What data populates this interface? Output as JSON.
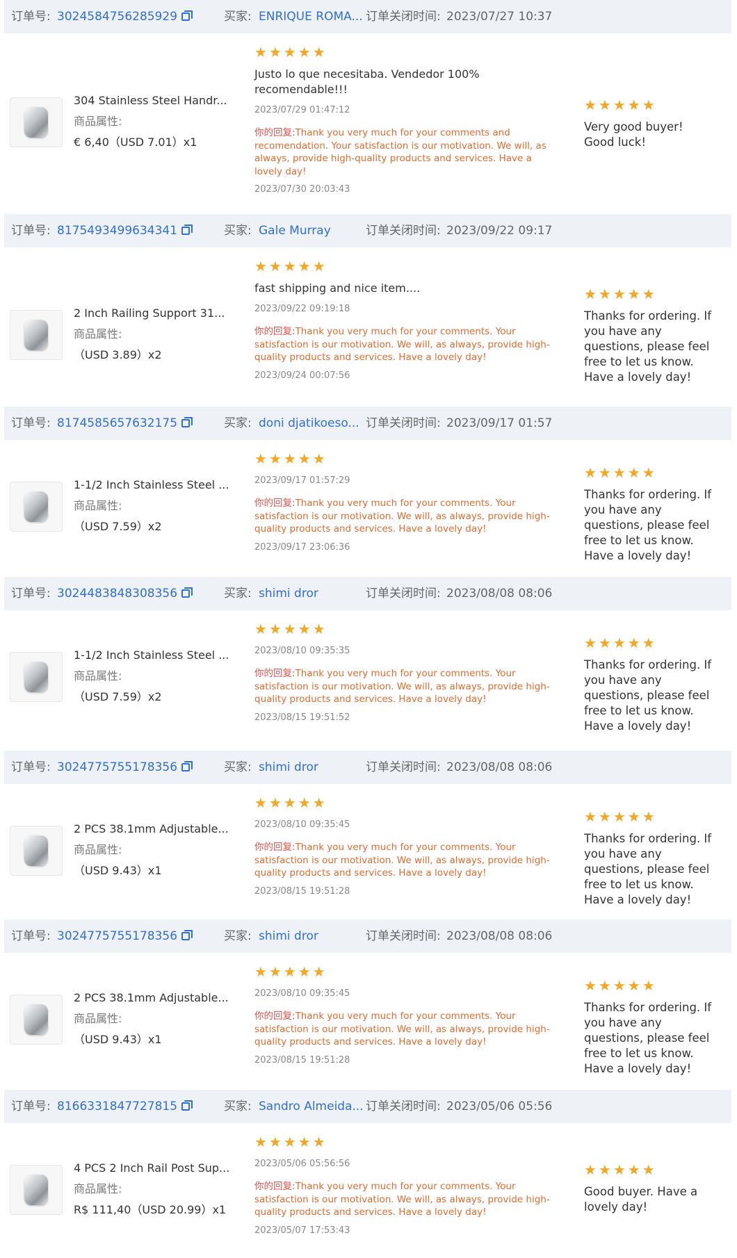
{
  "labels": {
    "order_no": "订单号:",
    "buyer": "买家:",
    "closed_time_prefix": "订单关闭时间:",
    "attributes": "商品属性:",
    "your_reply": "你的回复:"
  },
  "colors": {
    "link": "#2f6fd6",
    "star": "#f5a623",
    "reply": "#e06b2e",
    "header_bg": "#eef1f6"
  },
  "orders": [
    {
      "order_no": "3024584756285929",
      "buyer": "ENRIQUE ROMA...",
      "closed": "2023/07/27 10:37",
      "product_title": "304 Stainless Steel Handr...",
      "price": "€ 6,40（USD 7.01）x1",
      "stars": "★★★★★",
      "review_text": "Justo lo que necesitaba. Vendedor 100% recomendable!!!",
      "review_date": "2023/07/29 01:47:12",
      "reply": "Thank you very much for your comments and recomendation. Your satisfaction is our motivation. We will, as always, provide high-quality products and services. Have a lovely day!",
      "reply_date": "2023/07/30 20:03:43",
      "buyer_stars": "★★★★★",
      "buyer_text": "Very good buyer! Good luck!"
    },
    {
      "order_no": "8175493499634341",
      "buyer": "Gale Murray",
      "closed": "2023/09/22 09:17",
      "product_title": "2 Inch Railing Support 31...",
      "price": "（USD 3.89）x2",
      "stars": "★★★★★",
      "review_text": "fast shipping and nice item....",
      "review_date": "2023/09/22 09:19:18",
      "reply": "Thank you very much for your comments. Your satisfaction is our motivation. We will, as always, provide high-quality products and services. Have a lovely day!",
      "reply_date": "2023/09/24 00:07:56",
      "buyer_stars": "★★★★★",
      "buyer_text": "Thanks for ordering. If you have any questions, please feel free to let us know. Have a lovely day!"
    },
    {
      "order_no": "8174585657632175",
      "buyer": "doni djatikoeso...",
      "closed": "2023/09/17 01:57",
      "product_title": "1-1/2 Inch Stainless Steel ...",
      "price": "（USD 7.59）x2",
      "stars": "★★★★★",
      "review_text": "",
      "review_date": "2023/09/17 01:57:29",
      "reply": "Thank you very much for your comments. Your satisfaction is our motivation. We will, as always, provide high-quality products and services. Have a lovely day!",
      "reply_date": "2023/09/17 23:06:36",
      "buyer_stars": "★★★★★",
      "buyer_text": "Thanks for ordering. If you have any questions, please feel free to let us know. Have a lovely day!"
    },
    {
      "order_no": "3024483848308356",
      "buyer": "shimi dror",
      "closed": "2023/08/08 08:06",
      "product_title": "1-1/2 Inch Stainless Steel ...",
      "price": "（USD 7.59）x2",
      "stars": "★★★★★",
      "review_text": "",
      "review_date": "2023/08/10 09:35:35",
      "reply": "Thank you very much for your comments. Your satisfaction is our motivation. We will, as always, provide high-quality products and services. Have a lovely day!",
      "reply_date": "2023/08/15 19:51:52",
      "buyer_stars": "★★★★★",
      "buyer_text": "Thanks for ordering. If you have any questions, please feel free to let us know. Have a lovely day!"
    },
    {
      "order_no": "3024775755178356",
      "buyer": "shimi dror",
      "closed": "2023/08/08 08:06",
      "product_title": "2 PCS 38.1mm Adjustable...",
      "price": "（USD 9.43）x1",
      "stars": "★★★★★",
      "review_text": "",
      "review_date": "2023/08/10 09:35:45",
      "reply": "Thank you very much for your comments. Your satisfaction is our motivation. We will, as always, provide high-quality products and services. Have a lovely day!",
      "reply_date": "2023/08/15 19:51:28",
      "buyer_stars": "★★★★★",
      "buyer_text": "Thanks for ordering. If you have any questions, please feel free to let us know. Have a lovely day!"
    },
    {
      "order_no": "3024775755178356",
      "buyer": "shimi dror",
      "closed": "2023/08/08 08:06",
      "product_title": "2 PCS 38.1mm Adjustable...",
      "price": "（USD 9.43）x1",
      "stars": "★★★★★",
      "review_text": "",
      "review_date": "2023/08/10 09:35:45",
      "reply": "Thank you very much for your comments. Your satisfaction is our motivation. We will, as always, provide high-quality products and services. Have a lovely day!",
      "reply_date": "2023/08/15 19:51:28",
      "buyer_stars": "★★★★★",
      "buyer_text": "Thanks for ordering. If you have any questions, please feel free to let us know. Have a lovely day!"
    },
    {
      "order_no": "8166331847727815",
      "buyer": "Sandro Almeida...",
      "closed": "2023/05/06 05:56",
      "product_title": "4 PCS 2 Inch Rail Post Sup...",
      "price": "R$ 111,40（USD 20.99）x1",
      "stars": "★★★★★",
      "review_text": "",
      "review_date": "2023/05/06 05:56:56",
      "reply": "Thank you very much for your comments. Your satisfaction is our motivation. We will, as always, provide high-quality products and services. Have a lovely day!",
      "reply_date": "2023/05/07 17:53:43",
      "buyer_stars": "★★★★★",
      "buyer_text": "Good buyer. Have a lovely day!"
    }
  ]
}
